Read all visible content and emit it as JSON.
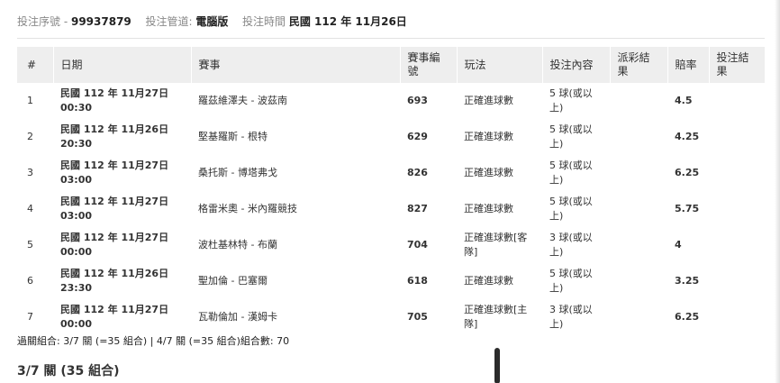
{
  "meta": {
    "serial_label": "投注序號 -",
    "serial_value": "99937879",
    "channel_label": "投注管道:",
    "channel_value": "電腦版",
    "time_label": "投注時間",
    "time_value": "民國 112 年 11月26日"
  },
  "table": {
    "headers": [
      "#",
      "日期",
      "賽事",
      "賽事編號",
      "玩法",
      "投注內容",
      "派彩結果",
      "賠率",
      "投注結果"
    ],
    "rows": [
      {
        "no": "1",
        "date": "民國 112 年 11月27日\n00:30",
        "match": "羅茲維澤夫 - 波茲南",
        "code": "693",
        "play": "正確進球數",
        "content": "5 球(或以上)",
        "payout": "",
        "odds": "4.5",
        "result": ""
      },
      {
        "no": "2",
        "date": "民國 112 年 11月26日\n20:30",
        "match": "堅基羅斯 - 根特",
        "code": "629",
        "play": "正確進球數",
        "content": "5 球(或以上)",
        "payout": "",
        "odds": "4.25",
        "result": ""
      },
      {
        "no": "3",
        "date": "民國 112 年 11月27日\n03:00",
        "match": "桑托斯 - 博塔弗戈",
        "code": "826",
        "play": "正確進球數",
        "content": "5 球(或以上)",
        "payout": "",
        "odds": "6.25",
        "result": ""
      },
      {
        "no": "4",
        "date": "民國 112 年 11月27日\n03:00",
        "match": "格雷米奧 - 米內羅競技",
        "code": "827",
        "play": "正確進球數",
        "content": "5 球(或以上)",
        "payout": "",
        "odds": "5.75",
        "result": ""
      },
      {
        "no": "5",
        "date": "民國 112 年 11月27日\n00:00",
        "match": "波杜基林特 - 布蘭",
        "code": "704",
        "play": "正確進球數[客隊]",
        "content": "3 球(或以上)",
        "payout": "",
        "odds": "4",
        "result": ""
      },
      {
        "no": "6",
        "date": "民國 112 年 11月26日\n23:30",
        "match": "聖加倫 - 巴塞爾",
        "code": "618",
        "play": "正確進球數",
        "content": "5 球(或以上)",
        "payout": "",
        "odds": "3.25",
        "result": ""
      },
      {
        "no": "7",
        "date": "民國 112 年 11月27日\n00:00",
        "match": "瓦勒倫加 - 漢姆卡",
        "code": "705",
        "play": "正確進球數[主隊]",
        "content": "3 球(或以上)",
        "payout": "",
        "odds": "6.25",
        "result": ""
      }
    ]
  },
  "summary": "過關組合: 3/7 關 (=35 組合) | 4/7 關 (=35 組合)組合數: 70",
  "section_title": "3/7 關 (35 組合)"
}
